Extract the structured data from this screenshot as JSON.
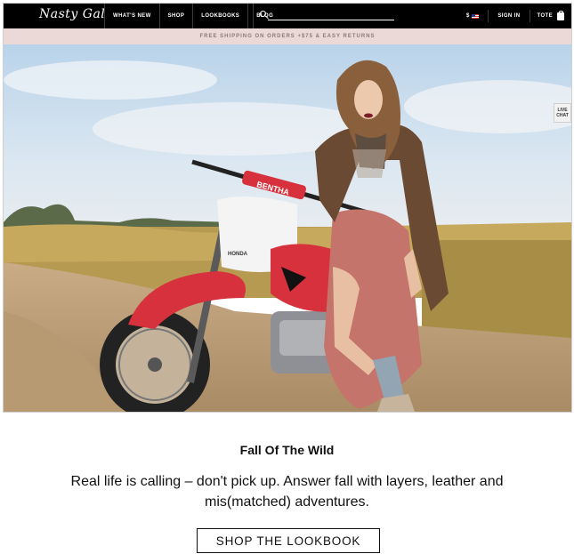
{
  "brand": {
    "logo_text": "Nasty Gal"
  },
  "nav": {
    "items": [
      {
        "label": "WHAT'S NEW"
      },
      {
        "label": "SHOP"
      },
      {
        "label": "LOOKBOOKS"
      },
      {
        "label": "BLOG"
      }
    ],
    "search": {
      "icon": "search-icon",
      "value": "",
      "placeholder": ""
    },
    "currency": {
      "label": "$",
      "flag_icon": "us-flag-icon"
    },
    "sign_in_label": "SIGN IN",
    "tote_label": "TOTE",
    "tote_icon": "shopping-bag-icon"
  },
  "promo": {
    "text": "FREE SHIPPING ON ORDERS +$75 & EASY RETURNS"
  },
  "hero": {
    "bike_decal": "BENTHA",
    "bike_brand": "HONDA"
  },
  "live_chat": {
    "line1": "LIVE",
    "line2": "CHAT"
  },
  "content": {
    "headline": "Fall Of The Wild",
    "body": "Real life is calling – don't pick up. Answer fall with layers, leather and mis(matched) adventures.",
    "cta_label": "SHOP THE LOOKBOOK"
  },
  "colors": {
    "nav_bg": "#000000",
    "promo_bg": "#ead9d7",
    "promo_text": "#8a7a78",
    "bike_red": "#d6313c"
  }
}
